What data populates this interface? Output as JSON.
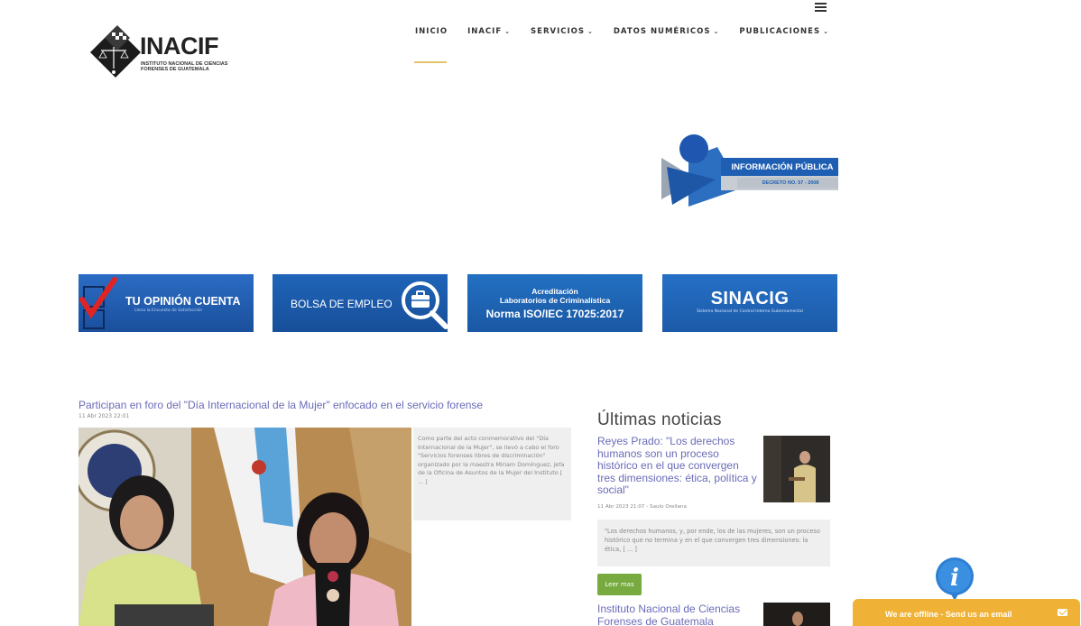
{
  "header": {
    "logo": {
      "name": "INACIF",
      "subtitle": "INSTITUTO NACIONAL DE CIENCIAS FORENSES DE GUATEMALA"
    },
    "nav": [
      {
        "label": "INICIO",
        "active": true,
        "dropdown": false
      },
      {
        "label": "INACIF",
        "dropdown": true
      },
      {
        "label": "SERVICIOS",
        "dropdown": true
      },
      {
        "label": "DATOS NUMÉRICOS",
        "dropdown": true
      },
      {
        "label": "PUBLICACIONES",
        "dropdown": true
      }
    ],
    "menu_icon": "hamburger-icon",
    "accent_color": "#e3c46a"
  },
  "info_publica": {
    "title": "INFORMACIÓN PÚBLICA",
    "subtitle": "DECRETO NO. 57 - 2008"
  },
  "banners": [
    {
      "title": "TU OPINIÓN CUENTA",
      "subtitle": "Llena la Encuesta de Satisfacción"
    },
    {
      "title": "BOLSA DE EMPLEO"
    },
    {
      "line1": "Acreditación",
      "line2": "Laboratorios de Criminalística",
      "line3": "Norma ISO/IEC 17025:2017"
    },
    {
      "title": "SINACIG",
      "subtitle": "Sistema Nacional de Control Interno Gubernamental"
    }
  ],
  "article": {
    "title": "Participan en foro del \"Día Internacional de la Mujer\" enfocado en el servicio forense",
    "date": "11 Abr 2023 22:01",
    "excerpt": "Como parte del acto conmemorativo del \"Día Internacional de la Mujer\", se llevó a cabo el foro \"Servicios forenses libres de discriminación\" organizado por la maestra Miriam Domínguez, jefa de la Oficina de Asuntos de la Mujer del Instituto  [ ... ]"
  },
  "news": {
    "heading": "Últimas noticias",
    "items": [
      {
        "title": "Reyes Prado: \"Los derechos humanos son un proceso histórico en el que convergen tres dimensiones: ética, política y social\"",
        "meta": "11 Abr 2023 21:07 - Saulo Orellana",
        "excerpt": "\"Los derechos humanos, y, por ende, los de las mujeres, son un proceso histórico que no termina y en el que convergen tres dimensiones: la ética,  [ ... ]",
        "read_more": "Leer mas"
      },
      {
        "title": "Instituto Nacional de Ciencias Forenses de Guatemala"
      }
    ],
    "link_color": "#6a6bb8",
    "button_color": "#77aa3f"
  },
  "chat": {
    "label": "We are offline - Send us an email",
    "icon": "info-icon",
    "color": "#f0b236"
  }
}
